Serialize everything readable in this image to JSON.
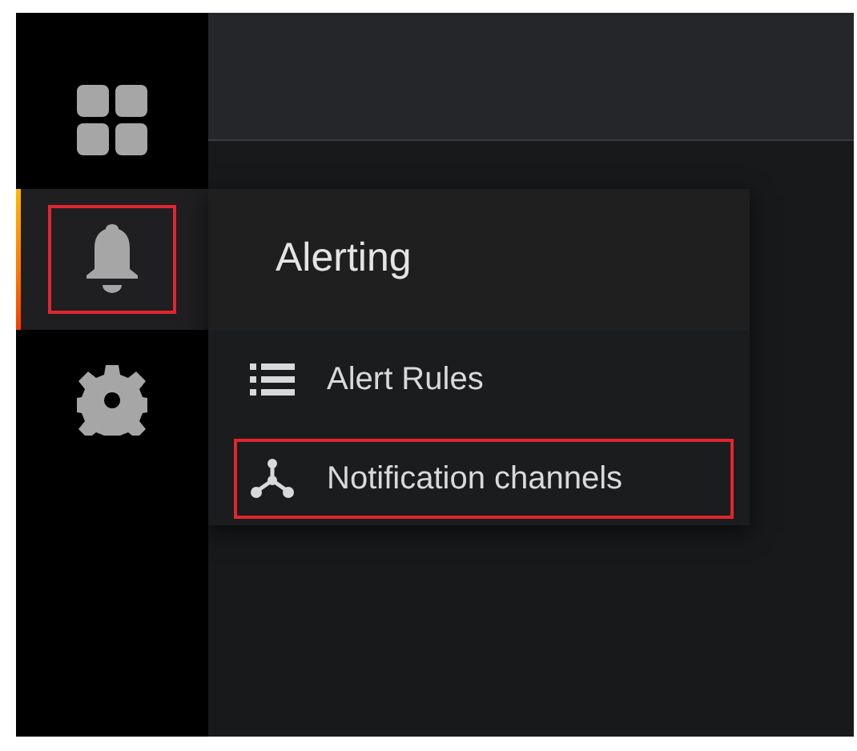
{
  "sidebar": {
    "items": [
      {
        "kind": "dashboards",
        "selected": false,
        "highlighted": false
      },
      {
        "kind": "alerting",
        "selected": true,
        "highlighted": true
      },
      {
        "kind": "configuration",
        "selected": false,
        "highlighted": false
      }
    ]
  },
  "flyout": {
    "title": "Alerting",
    "items": [
      {
        "kind": "list",
        "label": "Alert Rules",
        "highlighted": false
      },
      {
        "kind": "channels",
        "label": "Notification channels",
        "highlighted": true
      }
    ]
  }
}
